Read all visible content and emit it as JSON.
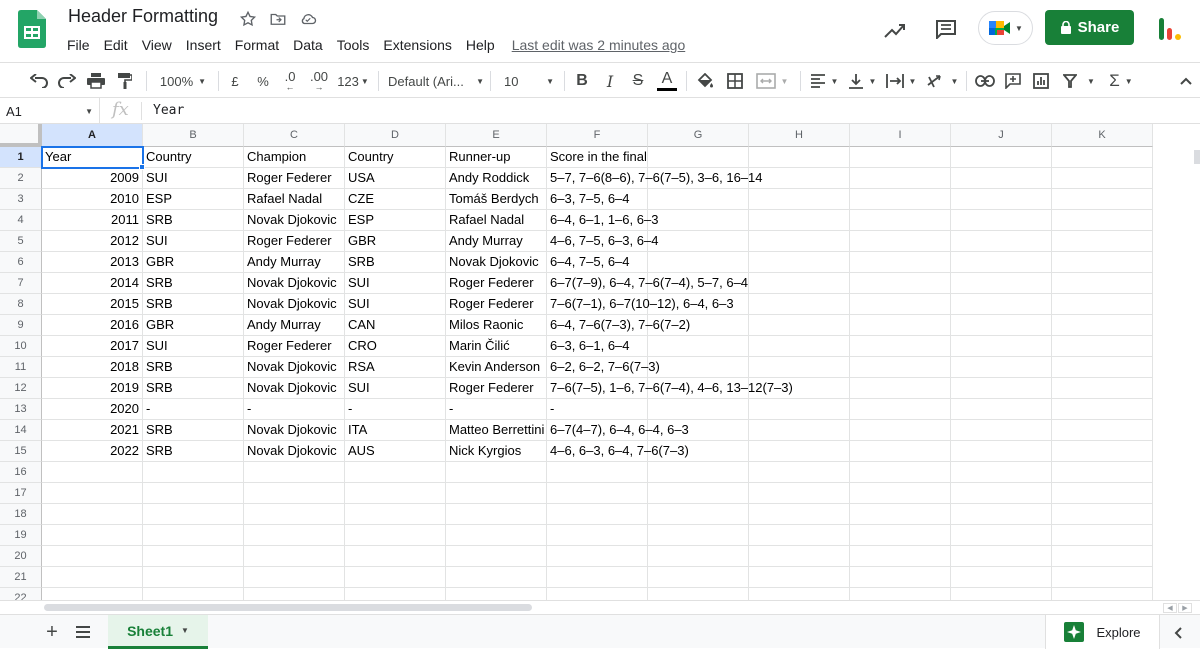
{
  "window": {
    "doc_title": "Header Formatting",
    "last_edit": "Last edit was 2 minutes ago",
    "share_label": "Share"
  },
  "menu": [
    "File",
    "Edit",
    "View",
    "Insert",
    "Format",
    "Data",
    "Tools",
    "Extensions",
    "Help"
  ],
  "toolbar": {
    "zoom": "100%",
    "currency": "£",
    "percent": "%",
    "decrease_decimal": ".0",
    "increase_decimal": ".00",
    "number_format": "123",
    "font": "Default (Ari...",
    "font_size": "10"
  },
  "formula_bar": {
    "cell_ref": "A1",
    "fx": "fx",
    "value": "Year"
  },
  "grid": {
    "columns": [
      "A",
      "B",
      "C",
      "D",
      "E",
      "F",
      "G",
      "H",
      "I",
      "J",
      "K"
    ],
    "row_numbers": [
      "1",
      "2",
      "3",
      "4",
      "5",
      "6",
      "7",
      "8",
      "9",
      "10",
      "11",
      "12",
      "13",
      "14",
      "15",
      "16",
      "17",
      "18",
      "19",
      "20",
      "21",
      "22"
    ],
    "rows": [
      [
        "Year",
        "Country",
        "Champion",
        "Country",
        "Runner-up",
        "Score in the final"
      ],
      [
        "2009",
        "SUI",
        "Roger Federer",
        "USA",
        "Andy Roddick",
        "5–7, 7–6(8–6), 7–6(7–5), 3–6, 16–14"
      ],
      [
        "2010",
        "ESP",
        "Rafael Nadal",
        "CZE",
        "Tomáš Berdych",
        "6–3, 7–5, 6–4"
      ],
      [
        "2011",
        "SRB",
        "Novak Djokovic",
        "ESP",
        "Rafael Nadal",
        "6–4, 6–1, 1–6, 6–3"
      ],
      [
        "2012",
        "SUI",
        "Roger Federer",
        "GBR",
        "Andy Murray",
        "4–6, 7–5, 6–3, 6–4"
      ],
      [
        "2013",
        "GBR",
        "Andy Murray",
        "SRB",
        "Novak Djokovic",
        "6–4, 7–5, 6–4"
      ],
      [
        "2014",
        "SRB",
        "Novak Djokovic",
        "SUI",
        "Roger Federer",
        "6–7(7–9), 6–4, 7–6(7–4), 5–7, 6–4"
      ],
      [
        "2015",
        "SRB",
        "Novak Djokovic",
        "SUI",
        "Roger Federer",
        "7–6(7–1), 6–7(10–12), 6–4, 6–3"
      ],
      [
        "2016",
        "GBR",
        "Andy Murray",
        "CAN",
        "Milos Raonic",
        "6–4, 7–6(7–3), 7–6(7–2)"
      ],
      [
        "2017",
        "SUI",
        "Roger Federer",
        "CRO",
        "Marin Čilić",
        "6–3, 6–1, 6–4"
      ],
      [
        "2018",
        "SRB",
        "Novak Djokovic",
        "RSA",
        "Kevin Anderson",
        "6–2, 6–2, 7–6(7–3)"
      ],
      [
        "2019",
        "SRB",
        "Novak Djokovic",
        "SUI",
        "Roger Federer",
        "7–6(7–5), 1–6, 7–6(7–4), 4–6, 13–12(7–3)"
      ],
      [
        "2020",
        "-",
        "-",
        "-",
        "-",
        "-"
      ],
      [
        "2021",
        "SRB",
        "Novak Djokovic",
        "ITA",
        "Matteo Berrettini",
        "6–7(4–7), 6–4, 6–4, 6–3"
      ],
      [
        "2022",
        "SRB",
        "Novak Djokovic",
        "AUS",
        "Nick Kyrgios",
        "4–6, 6–3, 6–4, 7–6(7–3)"
      ]
    ]
  },
  "sheets": {
    "active": "Sheet1",
    "explore_label": "Explore"
  },
  "colors": {
    "brand_green": "#188038",
    "selection_blue": "#1a73e8",
    "header_selected": "#d3e3fd"
  }
}
